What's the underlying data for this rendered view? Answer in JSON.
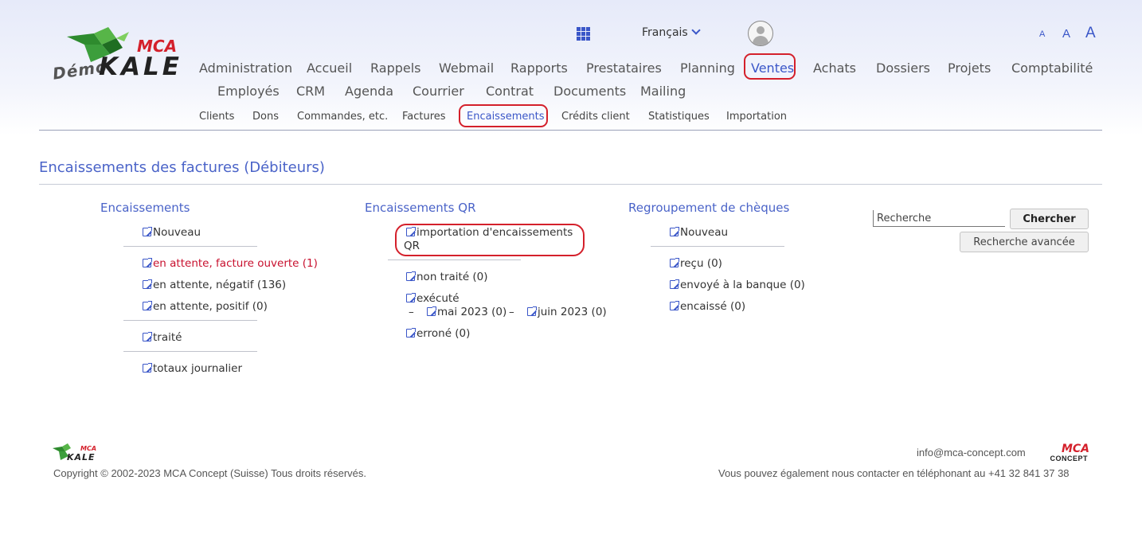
{
  "brand": {
    "demo_label": "Démo",
    "mca_label": "MCA",
    "kale_label": "KALE",
    "logo_colors": {
      "bird": "#2e8b2e",
      "accent": "#d4202b"
    }
  },
  "topbar": {
    "apps_icon": "grid-icon",
    "language": "Français",
    "avatar_icon": "user-icon",
    "font_sizes": [
      "A",
      "A",
      "A"
    ]
  },
  "nav": {
    "row1": [
      "Administration",
      "Accueil",
      "Rappels",
      "Webmail",
      "Rapports",
      "Prestataires",
      "Planning",
      "Ventes",
      "Achats",
      "Dossiers",
      "Projets",
      "Comptabilité"
    ],
    "row2": [
      "Employés",
      "CRM",
      "Agenda",
      "Courrier",
      "Contrat",
      "Documents",
      "Mailing"
    ],
    "active": "Ventes"
  },
  "subnav": {
    "items": [
      "Clients",
      "Dons",
      "Commandes, etc.",
      "Factures",
      "Encaissements",
      "Crédits client",
      "Statistiques",
      "Importation"
    ],
    "active": "Encaissements"
  },
  "page": {
    "title": "Encaissements des factures (Débiteurs)"
  },
  "col1": {
    "title": "Encaissements",
    "nouveau": "Nouveau",
    "attente_ouverte": "en attente, facture ouverte (1)",
    "attente_negatif": "en attente, négatif (136)",
    "attente_positif": "en attente, positif (0)",
    "traite": "traité",
    "totaux": "totaux journalier"
  },
  "col2": {
    "title": "Encaissements QR",
    "import_line1": "importation d'encaissements",
    "import_line2": "QR",
    "non_traite": "non traité (0)",
    "execute": "exécuté",
    "dash": "–",
    "mai": "mai 2023 (0)",
    "juin": "juin 2023 (0)",
    "errone": "erroné (0)"
  },
  "col3": {
    "title": "Regroupement de chèques",
    "nouveau": "Nouveau",
    "recu": "reçu (0)",
    "envoye": "envoyé à la banque (0)",
    "encaisse": "encaissé (0)"
  },
  "search": {
    "placeholder": "Recherche",
    "button": "Chercher",
    "advanced": "Recherche avancée"
  },
  "footer": {
    "mca": "MCA",
    "kale": "KALE",
    "copyright": "Copyright © 2002-2023 MCA Concept (Suisse) Tous droits réservés.",
    "email": "info@mca-concept.com",
    "phone_text": "Vous pouvez également nous contacter en téléphonant au +41 32 841 37 38",
    "concept_mca": "MCA",
    "concept_label": "CONCEPT"
  },
  "colors": {
    "accent_blue": "#3a56c8",
    "title_blue": "#4a63c8",
    "highlight_red": "#d4202b",
    "alert_red": "#c8102e"
  }
}
